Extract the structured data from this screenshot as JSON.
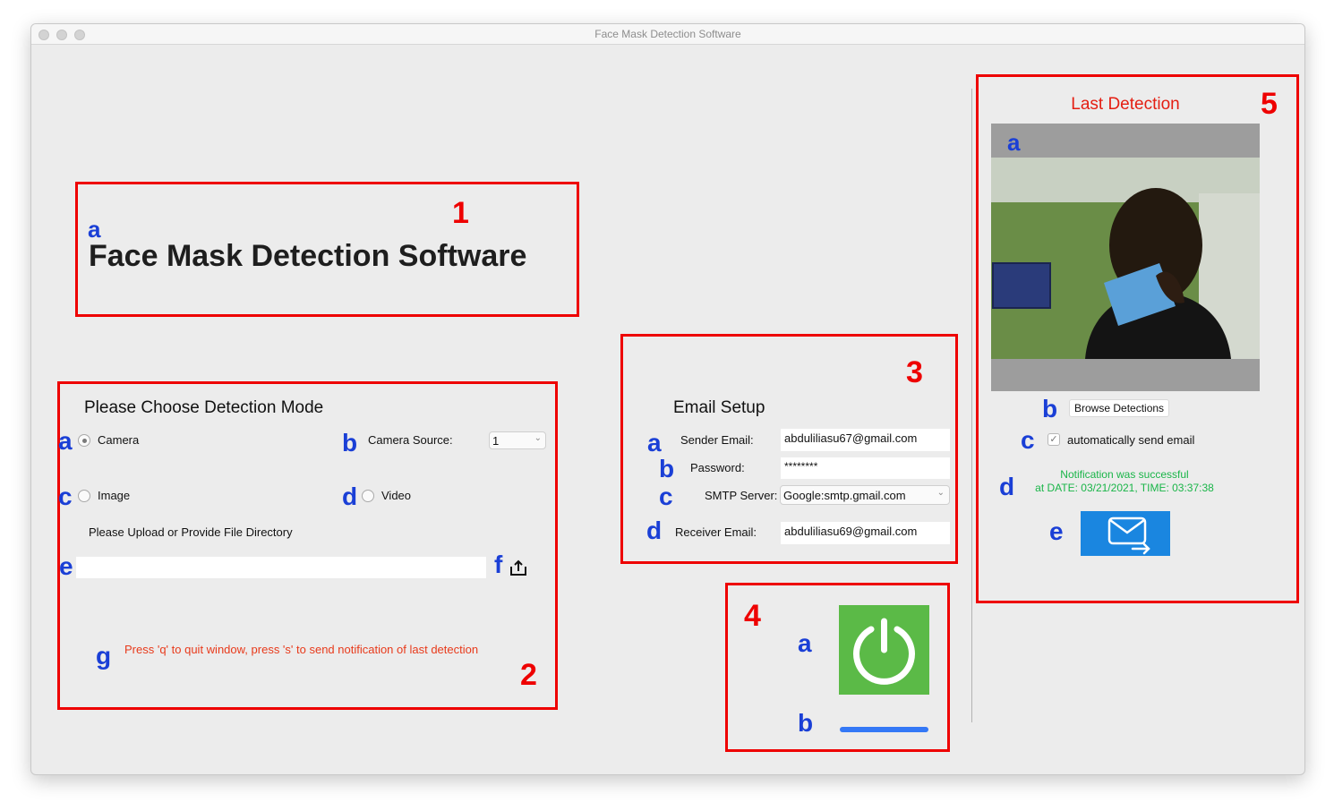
{
  "window": {
    "title": "Face Mask Detection Software"
  },
  "header": {
    "app_title": "Face Mask Detection Software"
  },
  "detection_mode": {
    "heading": "Please Choose Detection Mode",
    "camera_label": "Camera",
    "camera_selected": true,
    "camera_source_label": "Camera Source:",
    "camera_source_value": "1",
    "image_label": "Image",
    "video_label": "Video",
    "upload_prompt": "Please Upload or Provide File Directory",
    "file_path_value": "",
    "instructions": "Press 'q' to quit window, press 's' to send notification of last detection"
  },
  "email_setup": {
    "heading": "Email Setup",
    "sender_label": "Sender Email:",
    "sender_value": "abduliliasu67@gmail.com",
    "password_label": "Password:",
    "password_value": "********",
    "smtp_label": "SMTP Server:",
    "smtp_value": "Google:smtp.gmail.com",
    "receiver_label": "Receiver Email:",
    "receiver_value": "abduliliasu69@gmail.com"
  },
  "controls": {
    "power_icon": "power-icon",
    "progress_fraction": 1.0
  },
  "last_detection": {
    "heading": "Last Detection",
    "browse_label": "Browse Detections",
    "auto_send_label": "automatically send email",
    "auto_send_checked": true,
    "notification_line1": "Notification was successful",
    "notification_line2": "at DATE: 03/21/2021, TIME: 03:37:38",
    "send_icon": "mail-send-icon"
  },
  "annotations": {
    "n1": "1",
    "n2": "2",
    "n3": "3",
    "n4": "4",
    "n5": "5",
    "a": "a",
    "b": "b",
    "c": "c",
    "d": "d",
    "e": "e",
    "f": "f",
    "g": "g"
  },
  "colors": {
    "annotation_red": "#ee0000",
    "annotation_blue": "#1a3fd6",
    "power_button_green": "#5bba47",
    "send_button_blue": "#1a86e0",
    "success_green": "#19b548",
    "warning_red": "#e83a1b"
  }
}
